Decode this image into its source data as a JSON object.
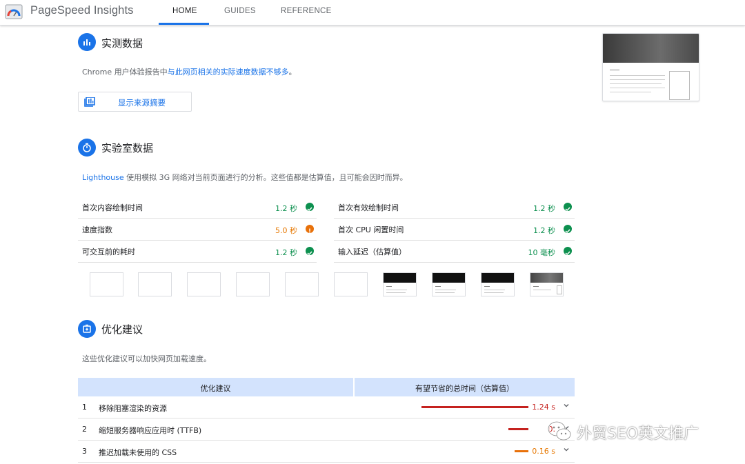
{
  "header": {
    "app_title": "PageSpeed Insights",
    "tabs": [
      {
        "label": "HOME",
        "active": true
      },
      {
        "label": "GUIDES",
        "active": false
      },
      {
        "label": "REFERENCE",
        "active": false
      }
    ],
    "accent_color": "#1a73e8"
  },
  "field_data": {
    "title": "实测数据",
    "icon": "bar-chart-icon",
    "desc_prefix": "Chrome 用户体验报告中",
    "desc_link": "与此网页相关的实际速度数据不够多",
    "desc_suffix": "。",
    "button_label": "显示来源摘要",
    "button_icon": "summary-icon"
  },
  "lab_data": {
    "title": "实验室数据",
    "icon": "stopwatch-icon",
    "desc_link": "Lighthouse",
    "desc_rest": " 使用模拟 3G 网络对当前页面进行的分析。这些值都是估算值，且可能会因时而异。",
    "metrics_left": [
      {
        "label": "首次内容绘制时间",
        "value": "1.2 秒",
        "status": "pass"
      },
      {
        "label": "速度指数",
        "value": "5.0 秒",
        "status": "average"
      },
      {
        "label": "可交互前的耗时",
        "value": "1.2 秒",
        "status": "pass"
      }
    ],
    "metrics_right": [
      {
        "label": "首次有效绘制时间",
        "value": "1.2 秒",
        "status": "pass"
      },
      {
        "label": "首次 CPU 闲置时间",
        "value": "1.2 秒",
        "status": "pass"
      },
      {
        "label": "输入延迟（估算值）",
        "value": "10 毫秒",
        "status": "pass"
      }
    ],
    "status_colors": {
      "pass": "#0d904f",
      "average": "#e8710a",
      "fail": "#c5221f"
    }
  },
  "opportunities": {
    "title": "优化建议",
    "icon": "opportunity-icon",
    "desc": "这些优化建议可以加快网页加载速度。",
    "col_opportunity": "优化建议",
    "col_savings": "有望节省的总时间（估算值）",
    "rows": [
      {
        "num": "1",
        "label": "移除阻塞渲染的资源",
        "value": "1.24 s",
        "level": "fail",
        "bar_fraction": 1.0
      },
      {
        "num": "2",
        "label": "缩短服务器响应应用时 (TTFB)",
        "value": "0.",
        "level": "fail",
        "bar_fraction": 0.19
      },
      {
        "num": "3",
        "label": "推迟加载未使用的 CSS",
        "value": "0.16 s",
        "level": "average",
        "bar_fraction": 0.13
      }
    ]
  },
  "watermark": {
    "text": "外贸SEO英文推广"
  }
}
